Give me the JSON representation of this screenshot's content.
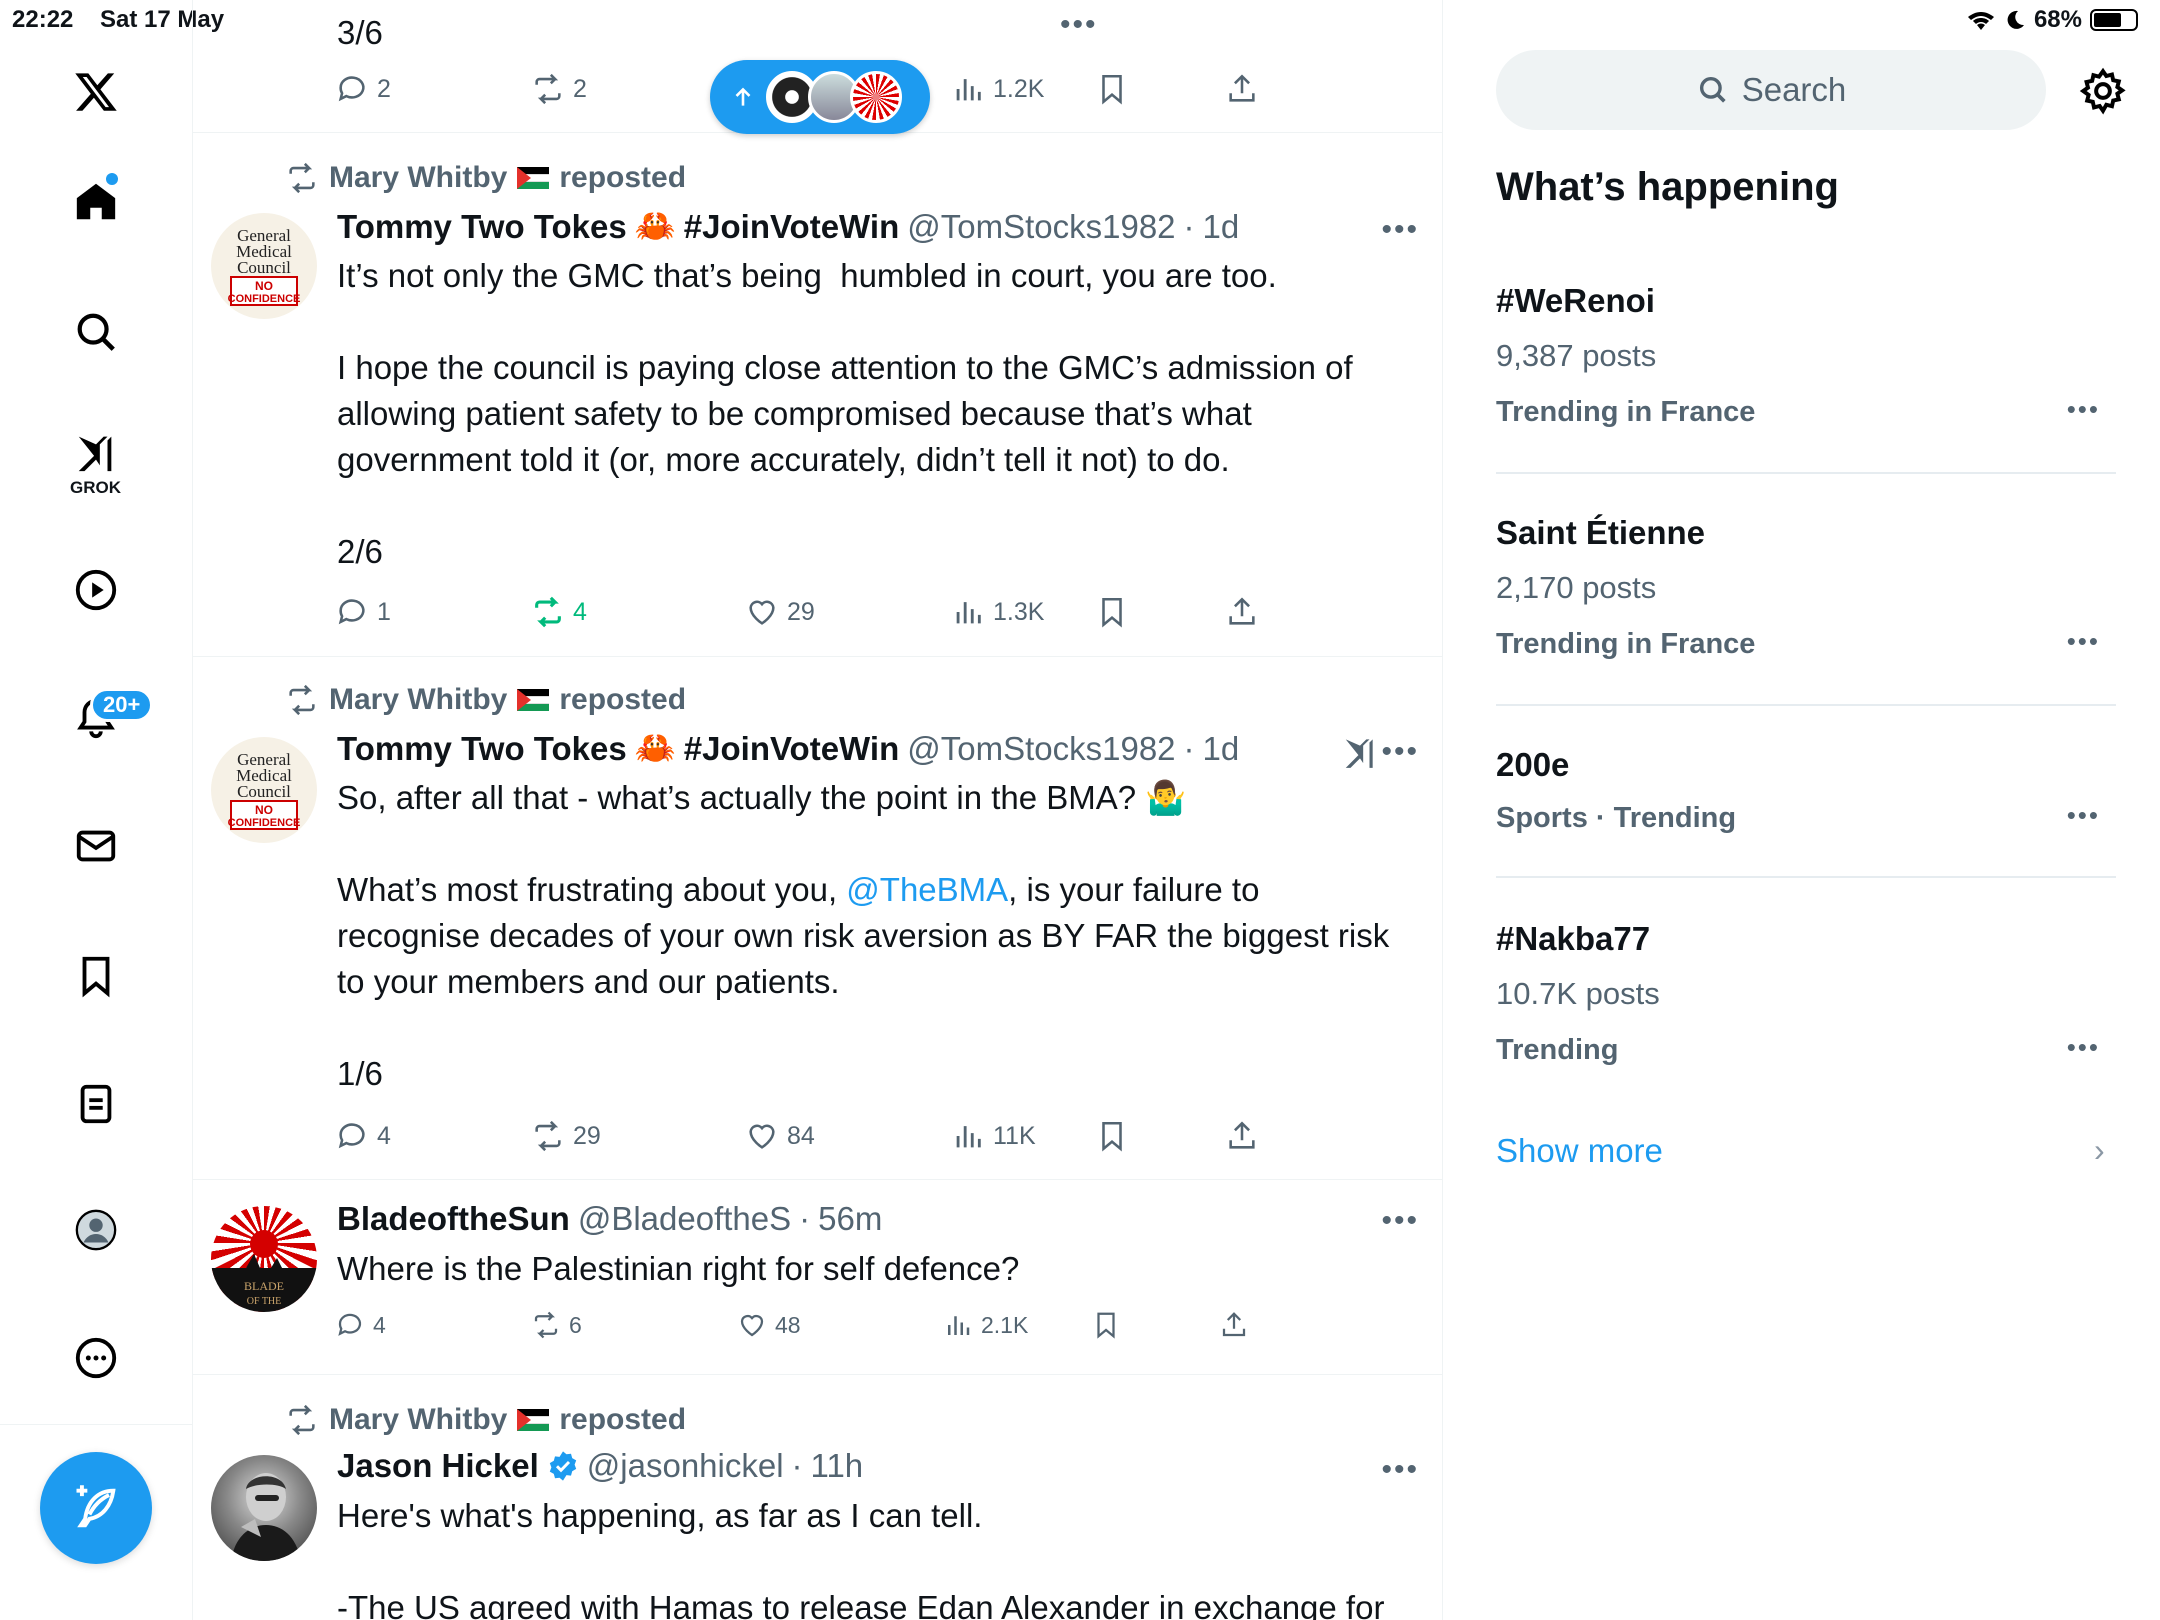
{
  "status": {
    "time": "22:22",
    "date": "Sat 17 May",
    "battery": "68%",
    "battery_fraction": 0.68
  },
  "nav": {
    "grok_label": "GROK",
    "notifications_badge": "20+"
  },
  "top_tweet": {
    "body": "3/6",
    "replies": "2",
    "reposts": "2",
    "views": "1.2K"
  },
  "tweets": [
    {
      "repost_by": "Mary Whitby",
      "repost_suffix": "reposted",
      "name": "Tommy Two Tokes",
      "name_emoji": "🦀",
      "hashtag": "#JoinVoteWin",
      "handle": "@TomStocks1982",
      "time": "1d",
      "avatar_text": [
        "General",
        "Medical",
        "Council",
        "NO",
        "CONFIDENCE"
      ],
      "body": "It’s not only the GMC that’s being  humbled in court, you are too.\n\nI hope the council is paying close attention to the GMC’s admission of allowing patient safety to be compromised because that’s what government told it (or, more accurately, didn’t tell it not) to do.\n\n2/6",
      "replies": "1",
      "reposts": "4",
      "likes": "29",
      "views": "1.3K"
    },
    {
      "repost_by": "Mary Whitby",
      "repost_suffix": "reposted",
      "name": "Tommy Two Tokes",
      "name_emoji": "🦀",
      "hashtag": "#JoinVoteWin",
      "handle": "@TomStocks1982",
      "time": "1d",
      "body_part1": "So, after all that - what’s actually the point in the BMA? 🤷‍♂️\n\nWhat’s most frustrating about you, ",
      "mention": "@TheBMA",
      "body_part2": ", is your failure to recognise decades of your own risk aversion as BY FAR the biggest risk to your members and our patients.\n\n1/6",
      "replies": "4",
      "reposts": "29",
      "likes": "84",
      "views": "11K"
    },
    {
      "name": "BladeoftheSun",
      "handle": "@BladeoftheS",
      "time": "56m",
      "body": "Where is the Palestinian right for self defence?",
      "replies": "4",
      "reposts": "6",
      "likes": "48",
      "views": "2.1K"
    },
    {
      "repost_by": "Mary Whitby",
      "repost_suffix": "reposted",
      "name": "Jason Hickel",
      "handle": "@jasonhickel",
      "time": "11h",
      "body": "Here's what's happening, as far as I can tell.\n\n-The US agreed with Hamas to release Edan Alexander in exchange for"
    }
  ],
  "right": {
    "search_placeholder": "Search",
    "title": "What’s happening",
    "trends": [
      {
        "tag": "#WeRenoi",
        "count": "9,387 posts",
        "context": "Trending in France"
      },
      {
        "tag": "Saint Étienne",
        "count": "2,170 posts",
        "context": "Trending in France"
      },
      {
        "tag": "200e",
        "count": "",
        "context": "Sports · Trending"
      },
      {
        "tag": "#Nakba77",
        "count": "10.7K posts",
        "context": "Trending"
      }
    ],
    "show_more": "Show more"
  },
  "colors": {
    "accent": "#1d9bf0",
    "muted": "#536471",
    "repost_green": "#00ba7c"
  }
}
